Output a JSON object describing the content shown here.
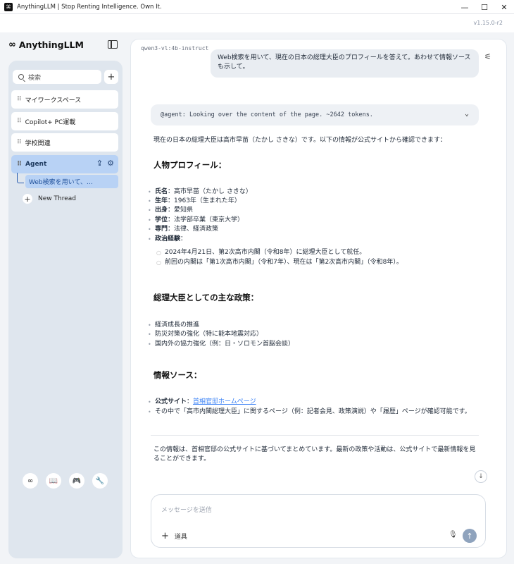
{
  "window": {
    "title": "AnythingLLM | Stop Renting Intelligence. Own It.",
    "app_icon": "⌘",
    "controls": [
      "—",
      "☐",
      "✕"
    ],
    "version": "v1.15.0-r2"
  },
  "sidebar": {
    "logo_mark": "∞",
    "logo_text": "AnythingLLM",
    "search_placeholder": "検索",
    "new_workspace": "+",
    "workspaces": [
      {
        "label": "マイワークスペース"
      },
      {
        "label": "Copilot+ PC運載"
      },
      {
        "label": "学校関連"
      },
      {
        "label": "Agent",
        "active": true
      }
    ],
    "active_thread": "Web検索を用いて、…",
    "new_thread": "New Thread",
    "bottom_icons": [
      "∞",
      "📖",
      "🎮",
      "🔧"
    ]
  },
  "chat": {
    "model": "qwen3-vl:4b-instruct",
    "user_message": "Web検索を用いて、現在の日本の総理大臣のプロフィールを答えて。あわせて情報ソースも示して。",
    "agent_status": "@agent: Looking over the content of the page. ~2642 tokens.",
    "intro": "現在の日本の総理大臣は高市早苗（たかし さきな）です。以下の情報が公式サイトから確認できます：",
    "section_profile": "人物プロフィール：",
    "profile": [
      {
        "key": "氏名",
        "value": "：高市早苗（たかし さきな）"
      },
      {
        "key": "生年",
        "value": "：1963年（生まれた年）"
      },
      {
        "key": "出身",
        "value": "：愛知県"
      },
      {
        "key": "学位",
        "value": "：法学部卒業（東京大学）"
      },
      {
        "key": "専門",
        "value": "：法律、経済政策"
      },
      {
        "key": "政治経験",
        "value": "："
      }
    ],
    "experience": [
      "2024年4月21日、第2次高市内閣（令和8年）に総理大臣として就任。",
      "前回の内閣は「第1次高市内閣」（令和7年）、現在は「第2次高市内閣」（令和8年）。"
    ],
    "section_policy": "総理大臣としての主な政策：",
    "policies": [
      "経済成長の推進",
      "防災対策の強化（特に能本地震対応）",
      "国内外の協力強化（例：日・ソロモン首脳会談）"
    ],
    "section_sources": "情報ソース：",
    "source_label": "公式サイト",
    "source_colon": "：",
    "source_link": "首相官邸ホームページ",
    "source_note": "その中で「高市内閣総理大臣」に関するページ（例：記者会見、政策演説）や「履歴」ページが確認可能です。",
    "summary": "この情報は、首相官邸の公式サイトに基づいてまとめています。最新の政策や活動は、公式サイトで最新情報を見ることができます。"
  },
  "composer": {
    "placeholder": "メッセージを送信",
    "tools_label": "道具"
  }
}
